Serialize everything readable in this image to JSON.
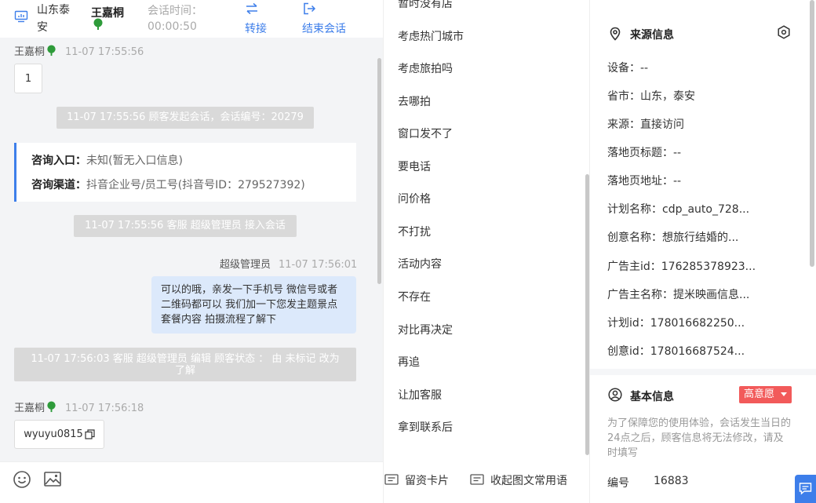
{
  "header": {
    "region": "山东泰安",
    "visitor_name": "王嘉桐",
    "session_time_label": "会话时间：",
    "session_time_value": "00:00:50",
    "transfer_label": "转接",
    "end_label": "结束会话"
  },
  "messages": {
    "visitor_name": "王嘉桐",
    "visitor_time_1": "11-07 17:55:56",
    "visitor_msg_1": "1",
    "system_1": "11-07 17:55:56 顾客发起会话，会话编号：20279",
    "entry_label": "咨询入口：",
    "entry_value": "未知(暂无入口信息)",
    "channel_label": "咨询渠道：",
    "channel_value": "抖音企业号/员工号(抖音号ID：279527392)",
    "system_2": "11-07 17:55:56 客服 超级管理员 接入会话",
    "agent_name": "超级管理员",
    "agent_time": "11-07 17:56:01",
    "agent_msg": "可以的哦，亲发一下手机号 微信号或者二维码都可以 我们加一下您发主题景点 套餐内容 拍摄流程了解下",
    "system_3": "11-07 17:56:03 客服 超级管理员 编辑 顾客状态 ： 由 未标记 改为 了解",
    "visitor_time_2": "11-07 17:56:18",
    "visitor_msg_2": "wyuyu0815"
  },
  "phrases": [
    "暂时没有店",
    "考虑热门城市",
    "考虑旅拍吗",
    "去哪拍",
    "窗口发不了",
    "要电话",
    "问价格",
    "不打扰",
    "活动内容",
    "不存在",
    "对比再决定",
    "再追",
    "让加客服",
    "拿到联系后"
  ],
  "phrase_footer": {
    "lead_card_label": "留资卡片",
    "collapse_label": "收起图文常用语"
  },
  "source_info": {
    "title": "来源信息",
    "rows": [
      "设备：--",
      "省市：山东，泰安",
      "来源：直接访问",
      "落地页标题：--",
      "落地页地址：--",
      "计划名称：cdp_auto_728...",
      "创意名称：想旅行结婚的...",
      "广告主id：176285378923...",
      "广告主名称：提米映画信息...",
      "计划id：178016682250...",
      "创意id：178016687524..."
    ]
  },
  "basic_info": {
    "title": "基本信息",
    "intent_tag": "高意愿",
    "notice": "为了保障您的使用体验，会话发生当日的24点之后，顾客信息将无法修改，请及时填写",
    "id_label": "编号",
    "id_value": "16883"
  },
  "colors": {
    "accent": "#3d7eea",
    "tag": "#f25a5a",
    "agent_bubble": "#dce9fb",
    "system_bubble": "#d9d9d9",
    "tree": "#2e9b3a"
  }
}
